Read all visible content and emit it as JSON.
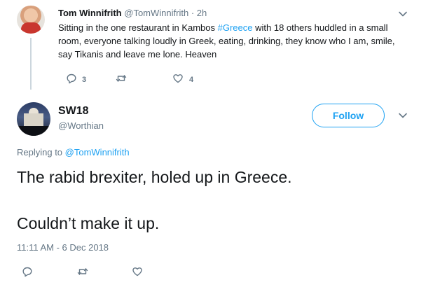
{
  "parent_tweet": {
    "author_name": "Tom Winnifrith",
    "author_handle": "@TomWinnifrith",
    "separator": "·",
    "time": "2h",
    "text_before": "Sitting in the one restaurant in Kambos ",
    "hashtag": "#Greece",
    "text_after": " with 18 others huddled in a small room, everyone talking loudly in Greek, eating, drinking, they know who I am, smile, say Tikanis and leave me lone. Heaven",
    "reply_count": "3",
    "retweet_count": "",
    "like_count": "4"
  },
  "main_tweet": {
    "author_name": "SW18",
    "author_handle": "@Worthian",
    "follow_label": "Follow",
    "replying_prefix": "Replying to ",
    "replying_to": "@TomWinnifrith",
    "line1": "The rabid brexiter, holed up in Greece.",
    "line2": "Couldn’t make it up.",
    "timestamp": "11:11 AM - 6 Dec 2018"
  },
  "icons": {
    "reply": "reply-icon",
    "retweet": "retweet-icon",
    "like": "heart-icon",
    "more": "chevron-down-icon"
  },
  "colors": {
    "accent": "#1da1f2",
    "text": "#14171a",
    "muted": "#657786"
  }
}
